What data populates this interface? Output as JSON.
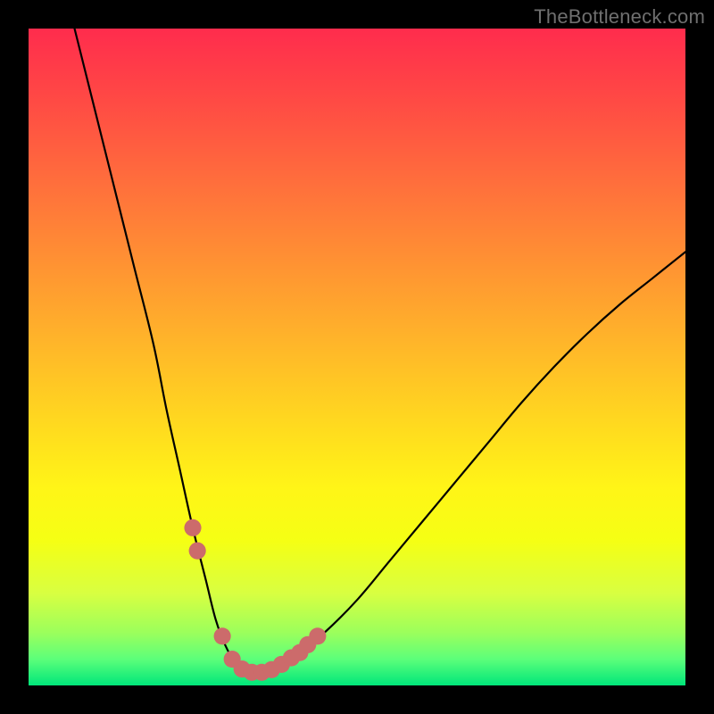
{
  "watermark": "TheBottleneck.com",
  "chart_data": {
    "type": "line",
    "title": "",
    "xlabel": "",
    "ylabel": "",
    "xlim": [
      0,
      100
    ],
    "ylim": [
      0,
      100
    ],
    "grid": false,
    "series": [
      {
        "name": "bottleneck-curve",
        "x": [
          7,
          10,
          13,
          16,
          19,
          21,
          23,
          25,
          27,
          28.5,
          30,
          31.5,
          33,
          35,
          37,
          40,
          45,
          50,
          55,
          60,
          65,
          70,
          75,
          80,
          85,
          90,
          95,
          100
        ],
        "values": [
          100,
          88,
          76,
          64,
          52,
          42,
          33,
          24,
          16,
          10,
          6,
          3.5,
          2.3,
          2,
          2.2,
          4,
          8,
          13,
          19,
          25,
          31,
          37,
          43,
          48.5,
          53.5,
          58,
          62,
          66
        ]
      }
    ],
    "markers": {
      "name": "highlight-dots",
      "color": "#cc6b6b",
      "radius_pct": 1.3,
      "points_pct": [
        {
          "x": 25.0,
          "y": 24.0
        },
        {
          "x": 25.7,
          "y": 20.5
        },
        {
          "x": 29.5,
          "y": 7.5
        },
        {
          "x": 31.0,
          "y": 4.0
        },
        {
          "x": 32.5,
          "y": 2.5
        },
        {
          "x": 34.0,
          "y": 2.0
        },
        {
          "x": 35.5,
          "y": 2.0
        },
        {
          "x": 37.0,
          "y": 2.4
        },
        {
          "x": 38.5,
          "y": 3.2
        },
        {
          "x": 40.0,
          "y": 4.2
        },
        {
          "x": 41.3,
          "y": 5.0
        },
        {
          "x": 42.5,
          "y": 6.2
        },
        {
          "x": 44.0,
          "y": 7.5
        }
      ]
    },
    "gradient_stops": [
      {
        "pos": 0.0,
        "color": "#ff2c4d"
      },
      {
        "pos": 0.1,
        "color": "#ff4745"
      },
      {
        "pos": 0.22,
        "color": "#ff6a3d"
      },
      {
        "pos": 0.34,
        "color": "#ff8d34"
      },
      {
        "pos": 0.46,
        "color": "#ffb02b"
      },
      {
        "pos": 0.58,
        "color": "#ffd321"
      },
      {
        "pos": 0.7,
        "color": "#fff517"
      },
      {
        "pos": 0.78,
        "color": "#f5ff14"
      },
      {
        "pos": 0.86,
        "color": "#d8ff41"
      },
      {
        "pos": 0.92,
        "color": "#9bff5c"
      },
      {
        "pos": 0.96,
        "color": "#5cff7a"
      },
      {
        "pos": 1.0,
        "color": "#00e67a"
      }
    ]
  }
}
